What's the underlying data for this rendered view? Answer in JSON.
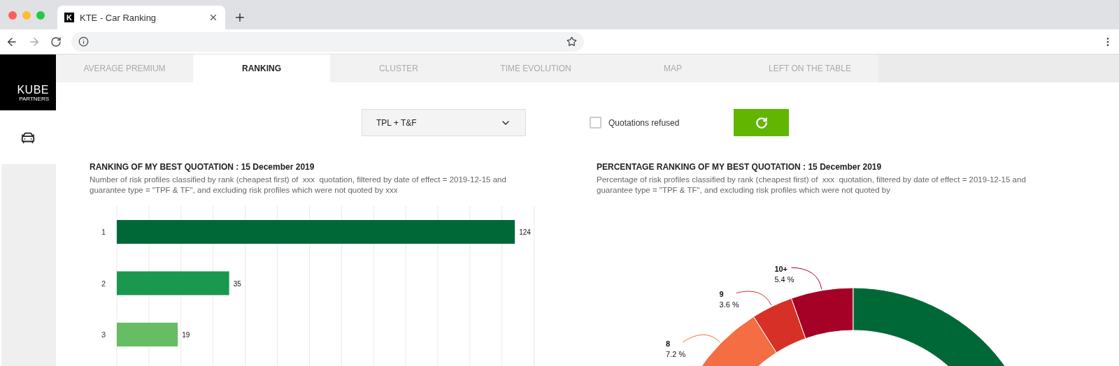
{
  "browser": {
    "favicon": "K",
    "tab_title": "KTE - Car Ranking"
  },
  "logo": {
    "name": "KUBE",
    "tagline": "PARTNERS"
  },
  "tabs": [
    {
      "label": "AVERAGE PREMIUM",
      "selected": false
    },
    {
      "label": "RANKING",
      "selected": true
    },
    {
      "label": "CLUSTER",
      "selected": false
    },
    {
      "label": "TIME EVOLUTION",
      "selected": false
    },
    {
      "label": "MAP",
      "selected": false
    },
    {
      "label": "LEFT ON THE TABLE",
      "selected": false
    }
  ],
  "controls": {
    "guarantee_select": {
      "value": "TPL + T&F"
    },
    "quotations_refused": {
      "label": "Quotations refused",
      "checked": false
    }
  },
  "panels": [
    {
      "title": "RANKING OF MY BEST QUOTATION : 15 December 2019",
      "description": "Number of risk profiles classified by rank (cheapest first) of  xxx  quotation, filtered by date of effect = 2019-12-15 and guarantee type = \"TPF & TF\", and excluding risk profiles which were not quoted by xxx",
      "chart_data": {
        "type": "bar",
        "orientation": "horizontal",
        "categories": [
          "1",
          "2",
          "3"
        ],
        "values": [
          124,
          35,
          19
        ],
        "data_labels": true
      }
    },
    {
      "title": "PERCENTAGE RANKING OF MY BEST QUOTATION : 15 December 2019",
      "description": "Percentage of risk profiles classified by rank (cheapest first) of  xxx  quotation, filtered by date of effect = 2019-12-15 and guarantee type = \"TPF & TF\", and excluding risk profiles which were not quoted by",
      "chart_data": {
        "type": "donut",
        "categories": [
          null,
          "8",
          "9",
          "10+"
        ],
        "values": [
          83.8,
          7.2,
          3.6,
          5.4
        ],
        "value_labels": [
          null,
          "7.2 %",
          "3.6 %",
          "5.4 %"
        ]
      }
    }
  ]
}
